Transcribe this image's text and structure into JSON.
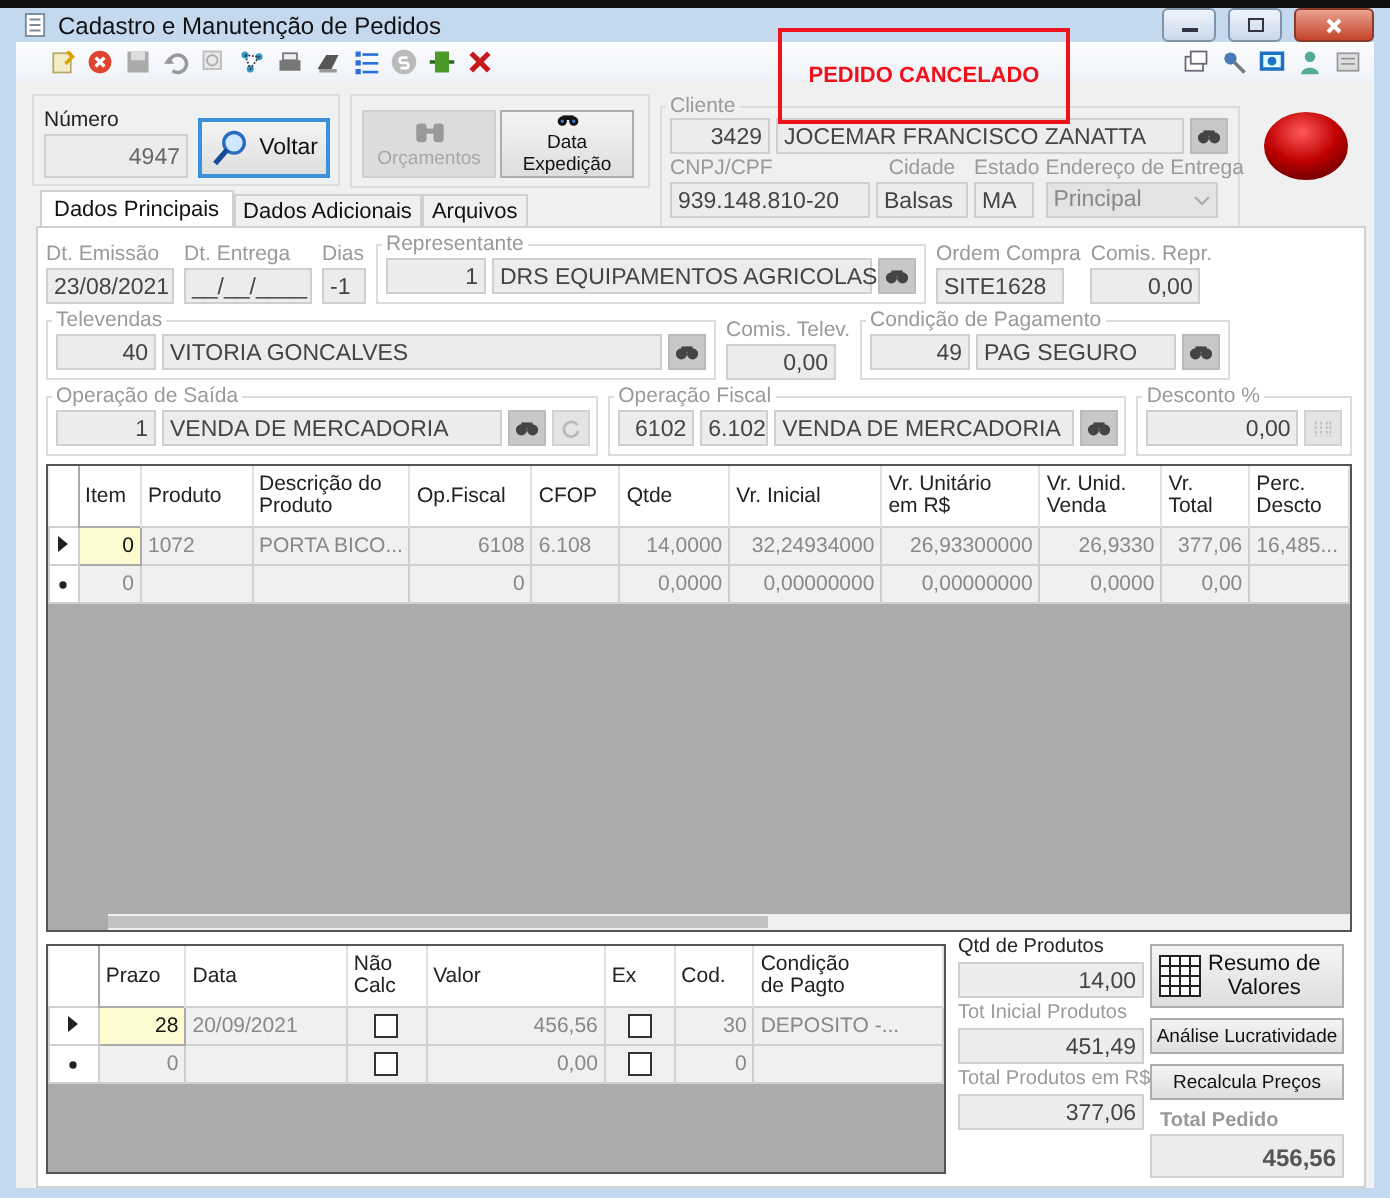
{
  "window": {
    "title": "Cadastro e Manutenção de Pedidos"
  },
  "banner": "PEDIDO CANCELADO",
  "numero": {
    "label": "Número",
    "value": "4947"
  },
  "voltar_button": {
    "label": "Voltar"
  },
  "orcamentos_button": {
    "label": "Orçamentos",
    "disabled": true
  },
  "expedicao_button": {
    "label": "Data Expedição",
    "disabled": false
  },
  "cliente": {
    "label": "Cliente",
    "code": "3429",
    "name": "JOCEMAR FRANCISCO ZANATTA"
  },
  "cnpj": {
    "label": "CNPJ/CPF",
    "value": "939.148.810-20"
  },
  "cidade": {
    "label": "Cidade",
    "value": "Balsas"
  },
  "estado": {
    "label": "Estado",
    "value": "MA"
  },
  "endereco": {
    "label": "Endereço de Entrega",
    "value": "Principal"
  },
  "tabs": [
    {
      "label": "Dados Principais",
      "selected": true
    },
    {
      "label": "Dados Adicionais",
      "selected": false
    },
    {
      "label": "Arquivos",
      "selected": false
    }
  ],
  "dt_emissao": {
    "label": "Dt. Emissão",
    "value": "23/08/2021"
  },
  "dt_entrega": {
    "label": "Dt. Entrega",
    "value": "__/__/____"
  },
  "dias": {
    "label": "Dias",
    "value": "-1"
  },
  "representante": {
    "label": "Representante",
    "code": "1",
    "name": "DRS EQUIPAMENTOS AGRICOLAS"
  },
  "ordem_compra": {
    "label": "Ordem Compra",
    "value": "SITE1628"
  },
  "comis_repr": {
    "label": "Comis. Repr.",
    "value": "0,00"
  },
  "televendas": {
    "label": "Televendas",
    "code": "40",
    "name": "VITORIA GONCALVES"
  },
  "comis_telev": {
    "label": "Comis. Telev.",
    "value": "0,00"
  },
  "condicao_pagamento": {
    "label": "Condição de Pagamento",
    "code": "49",
    "name": "PAG SEGURO"
  },
  "operacao_saida": {
    "label": "Operação de Saída",
    "code": "1",
    "name": "VENDA DE MERCADORIA"
  },
  "operacao_fiscal": {
    "label": "Operação Fiscal",
    "code": "6102",
    "cfop": "6.102",
    "name": "VENDA DE MERCADORIA"
  },
  "desconto": {
    "label": "Desconto %",
    "value": "0,00"
  },
  "items_table": {
    "columns": [
      "Item",
      "Produto",
      "Descrição do\nProduto",
      "Op.Fiscal",
      "CFOP",
      "Qtde",
      "Vr. Inicial",
      "Vr. Unitário\nem R$",
      "Vr. Unid.\nVenda",
      "Vr.\nTotal",
      "Perc.\nDescto"
    ],
    "rows": [
      {
        "kind": "current",
        "cells": [
          "0",
          "1072",
          "PORTA BICO...",
          "6108",
          "6.108",
          "14,0000",
          "32,24934000",
          "26,93300000",
          "26,9330",
          "377,06",
          "16,485..."
        ]
      },
      {
        "kind": "new",
        "cells": [
          "0",
          "",
          "",
          "0",
          "",
          "0,0000",
          "0,00000000",
          "0,00000000",
          "0,0000",
          "0,00",
          ""
        ]
      }
    ]
  },
  "payment_table": {
    "columns": [
      "Prazo",
      "Data",
      "Não\nCalc",
      "Valor",
      "Ex",
      "Cod.",
      "Condição\nde Pagto"
    ],
    "rows": [
      {
        "kind": "current",
        "prazo": "28",
        "data": "20/09/2021",
        "nao_calc": false,
        "valor": "456,56",
        "ex": false,
        "cod": "30",
        "condicao": "DEPOSITO -..."
      },
      {
        "kind": "new",
        "prazo": "0",
        "data": "",
        "nao_calc": false,
        "valor": "0,00",
        "ex": false,
        "cod": "0",
        "condicao": ""
      }
    ]
  },
  "totals": {
    "qtd_label": "Qtd de Produtos",
    "qtd": "14,00",
    "tot_inicial_label": "Tot Inicial Produtos",
    "tot_inicial": "451,49",
    "total_produtos_label": "Total Produtos em R$",
    "total_produtos": "377,06",
    "total_pedido_label": "Total Pedido",
    "total_pedido": "456,56"
  },
  "resumo_button": {
    "label": "Resumo de\nValores"
  },
  "analise_button": {
    "label": "Análise Lucratividade"
  },
  "recalcula_button": {
    "label": "Recalcula Preços"
  }
}
